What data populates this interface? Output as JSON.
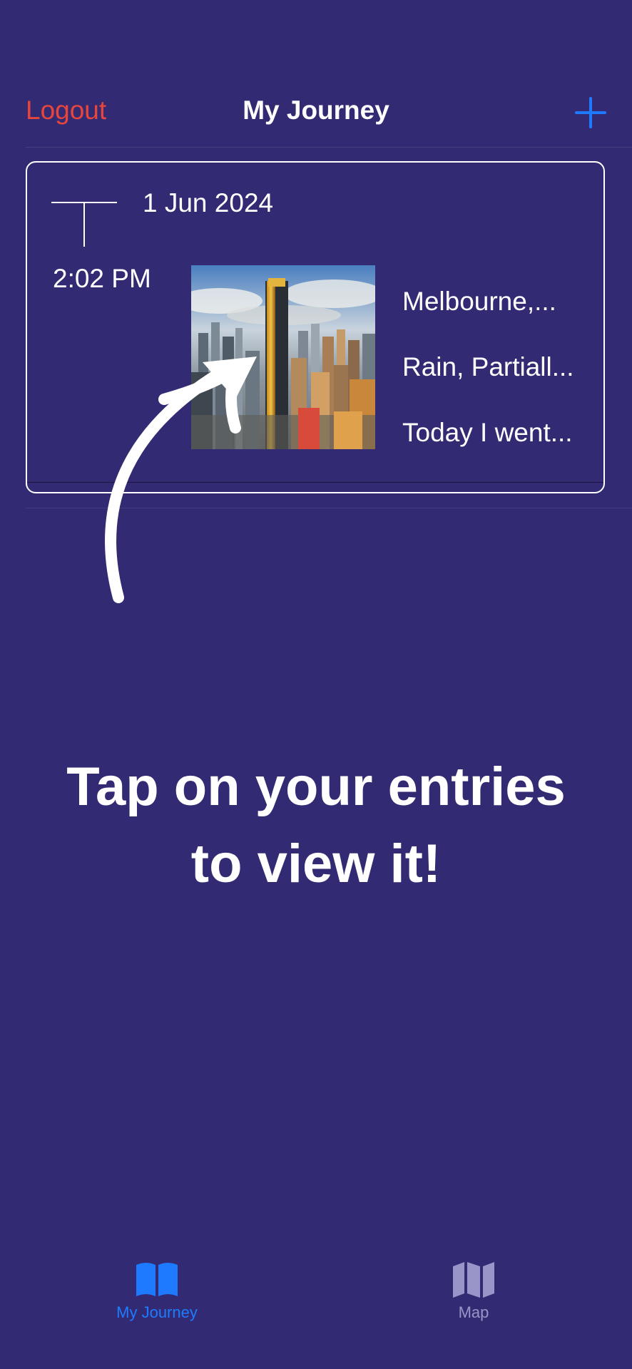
{
  "navbar": {
    "logout_label": "Logout",
    "title": "My Journey",
    "add_icon": "plus-icon"
  },
  "entries": [
    {
      "date": "1 Jun 2024",
      "time": "2:02 PM",
      "photo": "melbourne-skyline-photo",
      "location": "Melbourne,...",
      "weather": "Rain, Partiall...",
      "note": "Today I went..."
    }
  ],
  "hint": {
    "line1": "Tap on your entries",
    "line2": "to view it!"
  },
  "tabbar": {
    "tabs": [
      {
        "label": "My Journey",
        "icon": "open-book-icon",
        "selected": true
      },
      {
        "label": "Map",
        "icon": "map-icon",
        "selected": false
      }
    ]
  },
  "colors": {
    "background": "#322B73",
    "logout": "#E8453C",
    "accent": "#1E7BFF",
    "inactive_tab": "#9A95C8"
  }
}
